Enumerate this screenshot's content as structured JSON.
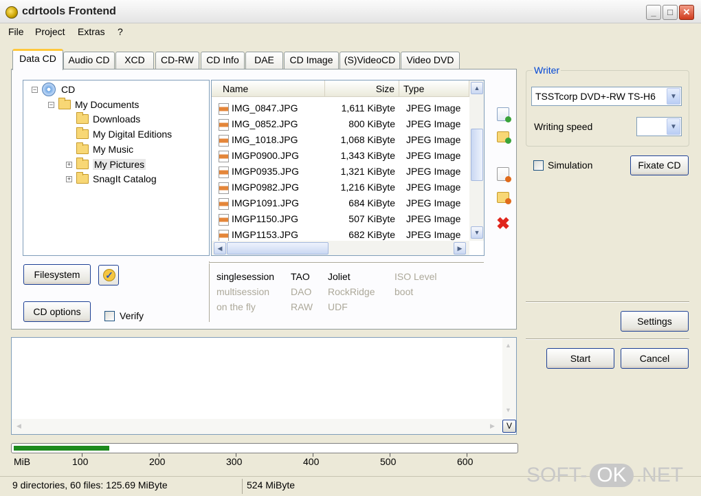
{
  "window": {
    "title": "cdrtools Frontend"
  },
  "menu": [
    "File",
    "Project",
    "Extras",
    "?"
  ],
  "tabs": [
    "Data CD",
    "Audio CD",
    "XCD",
    "CD-RW",
    "CD Info",
    "DAE",
    "CD Image",
    "(S)VideoCD",
    "Video DVD"
  ],
  "tree": {
    "root": "CD",
    "my_documents": "My Documents",
    "children": [
      "Downloads",
      "My Digital Editions",
      "My Music",
      "My Pictures",
      "SnagIt Catalog"
    ]
  },
  "file_list": {
    "columns": [
      "Name",
      "Size",
      "Type"
    ],
    "rows": [
      {
        "name": "IMG_0847.JPG",
        "size": "1,611 KiByte",
        "type": "JPEG Image"
      },
      {
        "name": "IMG_0852.JPG",
        "size": "800 KiByte",
        "type": "JPEG Image"
      },
      {
        "name": "IMG_1018.JPG",
        "size": "1,068 KiByte",
        "type": "JPEG Image"
      },
      {
        "name": "IMGP0900.JPG",
        "size": "1,343 KiByte",
        "type": "JPEG Image"
      },
      {
        "name": "IMGP0935.JPG",
        "size": "1,321 KiByte",
        "type": "JPEG Image"
      },
      {
        "name": "IMGP0982.JPG",
        "size": "1,216 KiByte",
        "type": "JPEG Image"
      },
      {
        "name": "IMGP1091.JPG",
        "size": "684 KiByte",
        "type": "JPEG Image"
      },
      {
        "name": "IMGP1150.JPG",
        "size": "507 KiByte",
        "type": "JPEG Image"
      },
      {
        "name": "IMGP1153.JPG",
        "size": "682 KiByte",
        "type": "JPEG Image"
      }
    ]
  },
  "buttons": {
    "filesystem": "Filesystem",
    "cd_options": "CD options",
    "verify": "Verify",
    "settings": "Settings",
    "start": "Start",
    "cancel": "Cancel",
    "fixate": "Fixate CD",
    "log_toggle": "V"
  },
  "options": {
    "row1": [
      "singlesession",
      "TAO",
      "Joliet",
      "ISO Level"
    ],
    "row2": [
      "multisession",
      "DAO",
      "RockRidge",
      "boot"
    ],
    "row3": [
      "on the fly",
      "RAW",
      "UDF"
    ]
  },
  "writer": {
    "group_label": "Writer",
    "device": "TSSTcorp DVD+-RW TS-H6",
    "speed_label": "Writing speed",
    "speed_value": "",
    "simulation": "Simulation"
  },
  "progress": {
    "unit": "MiB",
    "ticks": [
      "100",
      "200",
      "300",
      "400",
      "500",
      "600"
    ],
    "fill_fraction": 0.19
  },
  "status": {
    "summary": "9 directories, 60 files: 125.69 MiByte",
    "capacity": "524 MiByte"
  },
  "watermark": {
    "left": "SOFT-",
    "mid": "OK",
    "right": ".NET"
  }
}
